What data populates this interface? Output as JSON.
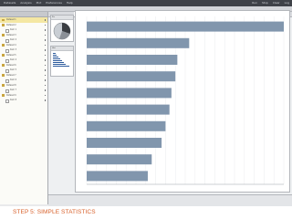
{
  "menubar": {
    "items": [
      "Datasets",
      "Analysis",
      "Plot",
      "Preferences",
      "Help"
    ],
    "right": [
      "Run",
      "Stop",
      "Clear",
      "Log"
    ]
  },
  "workspace": {
    "tab_label": "Results"
  },
  "panels": {
    "pie_title": "Pie",
    "hist_title": "Hist"
  },
  "sidebar": {
    "items": [
      {
        "label": "Dataset 1",
        "type": "folder",
        "selected": true
      },
      {
        "label": "Dataset 2",
        "type": "folder",
        "selected": false
      },
      {
        "label": "item 1",
        "type": "file",
        "selected": false
      },
      {
        "label": "Dataset 3",
        "type": "folder",
        "selected": false
      },
      {
        "label": "item 2",
        "type": "file",
        "selected": false
      },
      {
        "label": "Dataset 4",
        "type": "folder",
        "selected": false
      },
      {
        "label": "item 3",
        "type": "file",
        "selected": false
      },
      {
        "label": "Dataset 5",
        "type": "folder",
        "selected": false
      },
      {
        "label": "item 4",
        "type": "file",
        "selected": false
      },
      {
        "label": "Dataset 6",
        "type": "folder",
        "selected": false
      },
      {
        "label": "item 5",
        "type": "file",
        "selected": false
      },
      {
        "label": "Dataset 7",
        "type": "folder",
        "selected": false
      },
      {
        "label": "item 6",
        "type": "file",
        "selected": false
      },
      {
        "label": "Dataset 8",
        "type": "folder",
        "selected": false
      },
      {
        "label": "item 7",
        "type": "file",
        "selected": false
      },
      {
        "label": "Dataset 9",
        "type": "folder",
        "selected": false
      },
      {
        "label": "item 8",
        "type": "file",
        "selected": false
      }
    ]
  },
  "status": {
    "line1": "",
    "line2": ""
  },
  "caption": "STEP 5: SIMPLE STATISTICS",
  "colors": {
    "bar": "#8196ad",
    "caption": "#d8602a",
    "menubar": "#3f4248"
  },
  "chart_data": {
    "type": "bar",
    "orientation": "horizontal",
    "title": "",
    "categories": [
      "",
      "",
      "",
      "",
      "",
      "",
      "",
      "",
      "",
      ""
    ],
    "values": [
      100,
      52,
      46,
      45,
      43,
      42,
      40,
      38,
      33,
      31
    ],
    "xlim": [
      0,
      100
    ],
    "grid": true
  }
}
